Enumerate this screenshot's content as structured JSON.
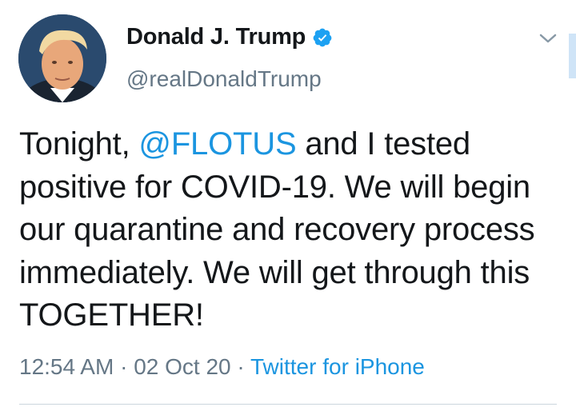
{
  "author": {
    "display_name": "Donald J. Trump",
    "handle": "@realDonaldTrump",
    "verified": true,
    "avatar_icon": "profile-photo"
  },
  "tweet": {
    "text_before_mention": "Tonight, ",
    "mention": "@FLOTUS",
    "text_after_mention": " and I tested positive for COVID-19. We will begin our quarantine and recovery process immediately. We will get through this TOGETHER!"
  },
  "meta": {
    "time": "12:54 AM",
    "separator": " · ",
    "date": "02 Oct 20",
    "source": "Twitter for iPhone"
  },
  "icons": {
    "verified": "verified-badge-icon",
    "menu": "chevron-down-icon"
  },
  "colors": {
    "text": "#14171a",
    "secondary": "#657786",
    "link": "#1b95e0",
    "verified": "#1da1f2"
  }
}
